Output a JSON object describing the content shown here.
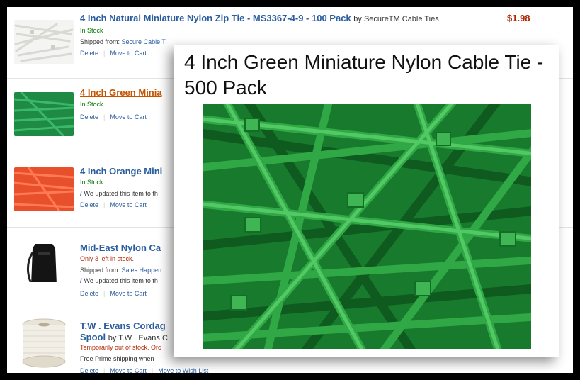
{
  "colors": {
    "link": "#2b5d9e",
    "visited": "#c45500",
    "price": "#b12704",
    "in_stock": "#007600"
  },
  "cart_items": [
    {
      "title": "4 Inch Natural Miniature Nylon Zip Tie - MS3367-4-9 - 100 Pack",
      "byline": "by SecureTM Cable Ties",
      "price": "$1.98",
      "stock": "In Stock",
      "shipped_label": "Shipped from:",
      "shipped_from": "Secure Cable Ti",
      "delete": "Delete",
      "move_to_cart": "Move to Cart",
      "thumb_icon": "white-zip-ties-image"
    },
    {
      "title": "4 Inch Green Minia",
      "stock": "In Stock",
      "delete": "Delete",
      "move_to_cart": "Move to Cart",
      "thumb_icon": "green-zip-ties-image"
    },
    {
      "title": "4 Inch Orange Mini",
      "stock": "In Stock",
      "notice": "We updated this item to th",
      "delete": "Delete",
      "move_to_cart": "Move to Cart",
      "thumb_icon": "orange-zip-ties-image"
    },
    {
      "title": "Mid-East Nylon Ca",
      "stock": "Only 3 left in stock.",
      "shipped_label": "Shipped from:",
      "shipped_from": "Sales Happen",
      "notice": "We updated this item to th",
      "delete": "Delete",
      "move_to_cart": "Move to Cart",
      "thumb_icon": "black-bag-image"
    },
    {
      "title": "T.W . Evans Cordag",
      "title_line2": "Spool",
      "byline": "by T.W . Evans C",
      "stock": "Temporarily out of stock. Orc",
      "shipping": "Free Prime shipping when",
      "delete": "Delete",
      "move_to_cart": "Move to Cart",
      "move_to_wishlist": "Move to Wish List",
      "thumb_icon": "white-cord-spool-image"
    }
  ],
  "zoom_overlay": {
    "title": "4 Inch Green Miniature Nylon Cable Tie - 500 Pack",
    "image_icon": "green-cable-ties-photo"
  }
}
